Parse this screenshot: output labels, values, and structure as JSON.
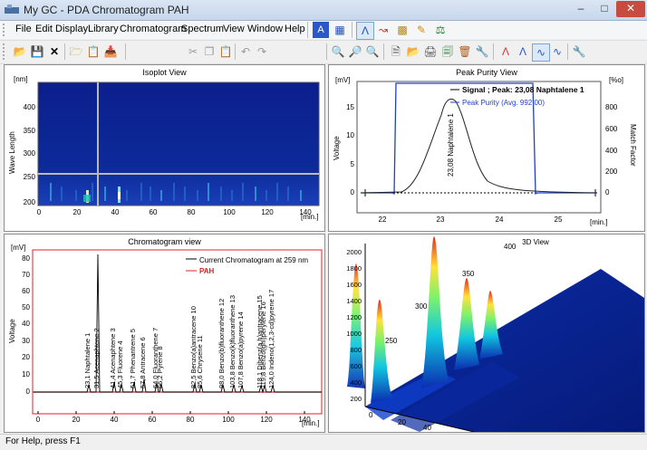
{
  "window": {
    "title": "My GC - PDA Chromatogram  PAH"
  },
  "menu": [
    "File",
    "Edit",
    "Display",
    "Library",
    "Chromatogram",
    "Spectrum",
    "View",
    "Window",
    "Help"
  ],
  "isoplot": {
    "title": "Isoplot View",
    "y_unit": "[nm]",
    "y_label": "Wave Length",
    "x_unit": "[min.]",
    "y_ticks": [
      "400",
      "350",
      "300",
      "250",
      "200"
    ],
    "x_ticks": [
      "0",
      "20",
      "40",
      "60",
      "80",
      "100",
      "120",
      "140"
    ]
  },
  "purity": {
    "title": "Peak Purity View",
    "y_unit": "[mV]",
    "y_label": "Voltage",
    "right_unit": "[%o]",
    "right_label": "Match Factor",
    "x_unit": "[min.]",
    "legend_signal": "Signal ; Peak: 23,08 Naphtalene   1",
    "legend_purity": "Peak Purity  (Avg. 992,00)",
    "peak_label": "23,08 Naphtalene   1",
    "y_ticks": [
      "15",
      "10",
      "5",
      "0"
    ],
    "right_ticks": [
      "800",
      "600",
      "400",
      "200",
      "0"
    ],
    "x_ticks": [
      "22",
      "23",
      "24",
      "25"
    ],
    "colors": {
      "signal": "#000000",
      "purity": "#1f3fd0"
    }
  },
  "chromatogram": {
    "title": "Chromatogram view",
    "y_unit": "[mV]",
    "y_label": "Voltage",
    "x_unit": "[min.]",
    "legend_current": "Current Chromatogram at 259 nm",
    "legend_pah": "PAH",
    "y_ticks": [
      "80",
      "70",
      "60",
      "50",
      "40",
      "30",
      "20",
      "10",
      "0"
    ],
    "x_ticks": [
      "0",
      "20",
      "40",
      "60",
      "80",
      "100",
      "120",
      "140"
    ],
    "peaks": [
      "23,1 Naphtalene   1",
      "31,5 Acenaphtene   2",
      "41,4 Acenaphtene   3",
      "45,3 Fluorene   4",
      "51,7 Phenantrene   5",
      "57,8 Antracene   6",
      "64,0 Fluoranthene   7",
      "66,2 Pyrene   8",
      "82,5 Benzo(a)antracene   10",
      "85,6 Chrysene   11",
      "98,0 Benzo(b)fluoranthene   12",
      "103,8 Benzo(k)fluoranthene   13",
      "107,8 Benzo(a)pyrene   14",
      "118,1 Dibenz(a,h)antracene   15",
      "119,8 Benzo(ghi)perylene   16",
      "124,0 Indeno(1,2,3-cd)pyrene   17"
    ]
  },
  "view3d": {
    "title": "3D View",
    "wl_ticks": [
      "400",
      "350",
      "300",
      "250"
    ],
    "y_ticks": [
      "2000",
      "1800",
      "1600",
      "1400",
      "1200",
      "1000",
      "800",
      "600",
      "400",
      "200"
    ],
    "x_ticks": [
      "0",
      "20",
      "40"
    ]
  },
  "status": "For Help, press F1"
}
